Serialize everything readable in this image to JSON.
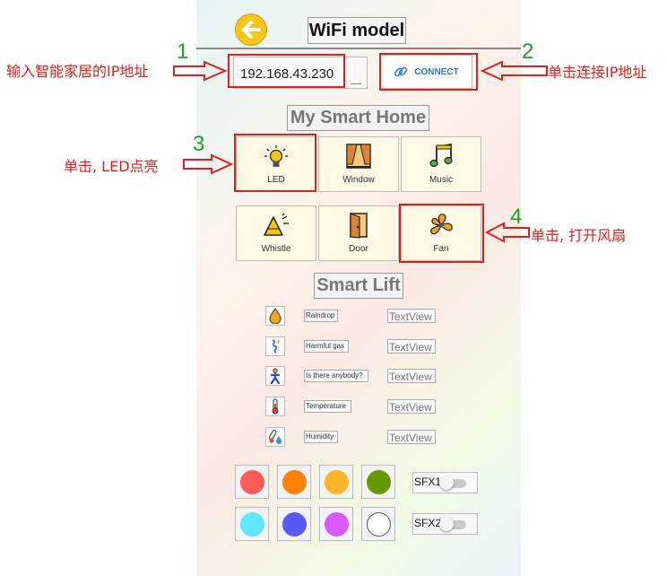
{
  "header": {
    "title": "WiFi model",
    "back_icon": "arrow-left-icon"
  },
  "connection": {
    "ip_value": "192.168.43.230",
    "connect_label": "CONNECT",
    "connect_icon": "link-icon",
    "accent": "#2e7bd6"
  },
  "home": {
    "title": "My Smart Home",
    "tiles": [
      {
        "label": "LED",
        "icon": "bulb-icon"
      },
      {
        "label": "Window",
        "icon": "window-icon"
      },
      {
        "label": "Music",
        "icon": "music-note-icon"
      },
      {
        "label": "Whistle",
        "icon": "horn-icon"
      },
      {
        "label": "Door",
        "icon": "door-icon"
      },
      {
        "label": "Fan",
        "icon": "fan-icon"
      }
    ]
  },
  "lift": {
    "title": "Smart Lift",
    "sensors": [
      {
        "label": "Raindrop",
        "value": "TextView",
        "icon": "raindrop-icon"
      },
      {
        "label": "Harmful gas",
        "value": "TextView",
        "icon": "gas-icon"
      },
      {
        "label": "Is there anybody?",
        "value": "TextView",
        "icon": "person-icon"
      },
      {
        "label": "Temperature",
        "value": "TextView",
        "icon": "thermometer-icon"
      },
      {
        "label": "Humidity",
        "value": "TextView",
        "icon": "humidity-icon"
      }
    ]
  },
  "colors": {
    "row1": [
      "#fd5a5c",
      "#fc8006",
      "#fcb52b",
      "#669704"
    ],
    "row2": [
      "#5ee6fc",
      "#5b5af9",
      "#d85cfd",
      "#ffffff"
    ]
  },
  "sfx": [
    {
      "label": "SFX1",
      "on": false
    },
    {
      "label": "SFX2",
      "on": false
    }
  ],
  "annotations": {
    "step1": {
      "num": "1",
      "text": "输入智能家居的IP地址"
    },
    "step2": {
      "num": "2",
      "text": "单击连接IP地址"
    },
    "step3": {
      "num": "3",
      "text": "单击, LED点亮"
    },
    "step4": {
      "num": "4",
      "text": "单击, 打开风扇"
    },
    "color": "#e0201c",
    "number_color": "#1da12a"
  }
}
